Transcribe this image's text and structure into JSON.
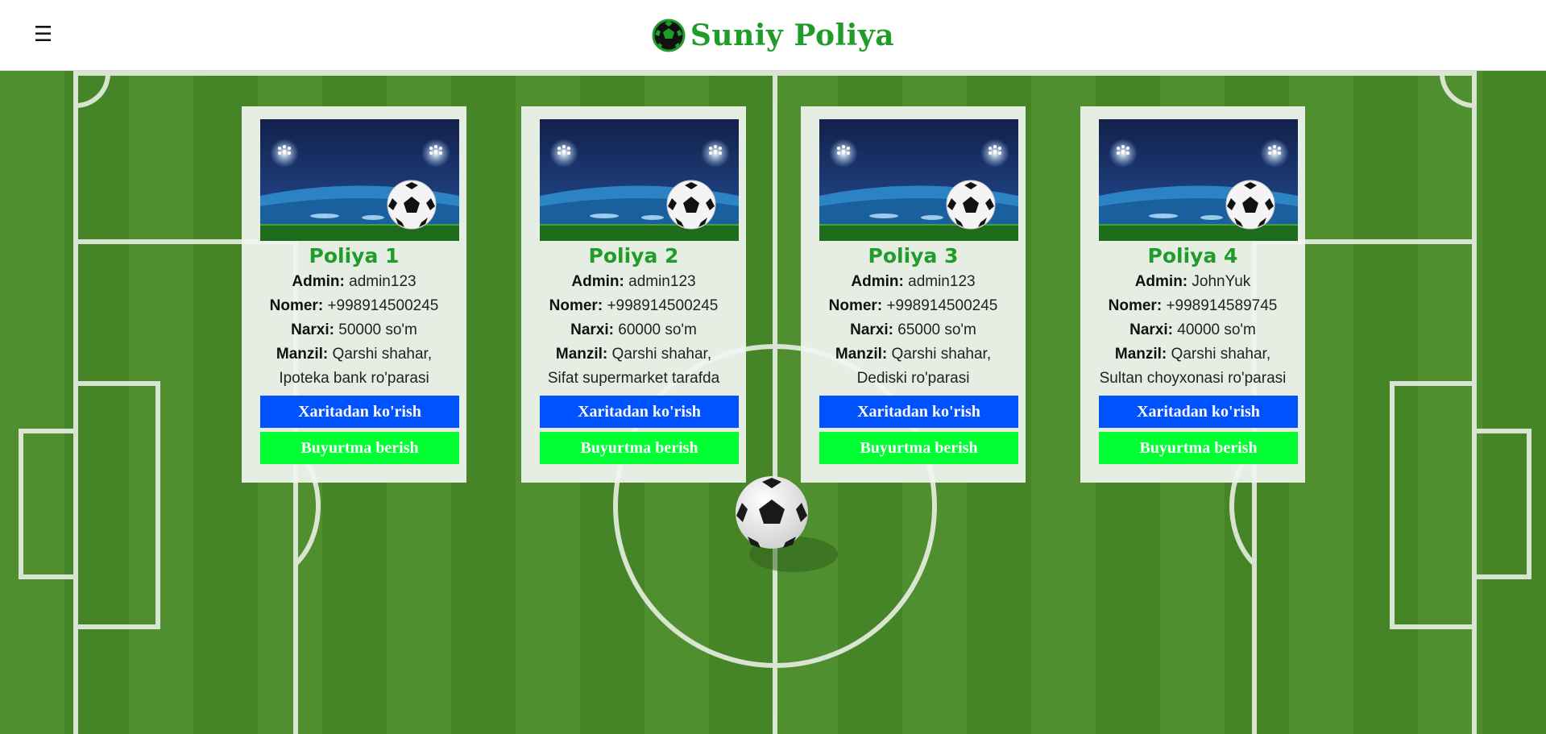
{
  "header": {
    "menu_icon": "☰",
    "title": "Suniy Poliya",
    "brand_color": "#1f9c2a"
  },
  "cards": [
    {
      "title": "Poliya 1",
      "admin_label": "Admin:",
      "admin": "admin123",
      "phone_label": "Nomer:",
      "phone": "+998914500245",
      "price_label": "Narxi:",
      "price": "50000 so'm",
      "address_label": "Manzil:",
      "address": "Qarshi shahar, Ipoteka bank ro'parasi",
      "map_button": "Xaritadan ko'rish",
      "order_button": "Buyurtma berish"
    },
    {
      "title": "Poliya 2",
      "admin_label": "Admin:",
      "admin": "admin123",
      "phone_label": "Nomer:",
      "phone": "+998914500245",
      "price_label": "Narxi:",
      "price": "60000 so'm",
      "address_label": "Manzil:",
      "address": "Qarshi shahar, Sifat supermarket tarafda",
      "map_button": "Xaritadan ko'rish",
      "order_button": "Buyurtma berish"
    },
    {
      "title": "Poliya 3",
      "admin_label": "Admin:",
      "admin": "admin123",
      "phone_label": "Nomer:",
      "phone": "+998914500245",
      "price_label": "Narxi:",
      "price": "65000 so'm",
      "address_label": "Manzil:",
      "address": "Qarshi shahar, Dediski ro'parasi",
      "map_button": "Xaritadan ko'rish",
      "order_button": "Buyurtma berish"
    },
    {
      "title": "Poliya 4",
      "admin_label": "Admin:",
      "admin": "JohnYuk",
      "phone_label": "Nomer:",
      "phone": "+998914589745",
      "price_label": "Narxi:",
      "price": "40000 so'm",
      "address_label": "Manzil:",
      "address": "Qarshi shahar, Sultan choyxonasi ro'parasi",
      "map_button": "Xaritadan ko'rish",
      "order_button": "Buyurtma berish"
    }
  ],
  "colors": {
    "map_button": "#0052ff",
    "order_button": "#00ff33",
    "field_grass": "#4a8a2c"
  }
}
